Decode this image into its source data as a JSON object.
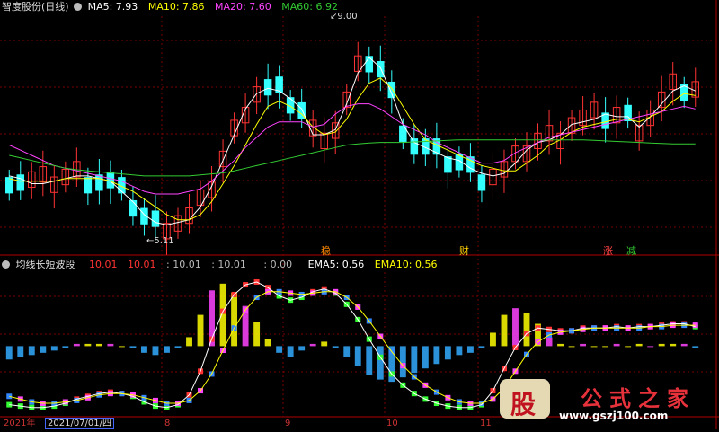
{
  "top_panel": {
    "title": "智度股份(日线)",
    "ma_labels": [
      {
        "text": "MA5: 7.93",
        "color": "#ffffff"
      },
      {
        "text": "MA10: 7.86",
        "color": "#ffff00"
      },
      {
        "text": "MA20: 7.60",
        "color": "#ff44ff"
      },
      {
        "text": "MA60: 6.92",
        "color": "#33cc33"
      }
    ],
    "high_label": "9.00",
    "low_label": "5.11",
    "events": [
      {
        "text": "稳",
        "color": "#ff8800"
      },
      {
        "text": "财",
        "color": "#ffd000"
      },
      {
        "text": "涨",
        "color": "#ff4444"
      },
      {
        "text": "减",
        "color": "#33cc33"
      }
    ]
  },
  "bottom_panel": {
    "title": "均线长短波段",
    "values": [
      {
        "text": "10.01",
        "color": "#ff3333"
      },
      {
        "text": "10.01",
        "color": "#ff3333"
      },
      {
        "text": ": 10.01",
        "color": "#bbbbbb"
      },
      {
        "text": ": 10.01",
        "color": "#bbbbbb"
      },
      {
        "text": ": 0.00",
        "color": "#bbbbbb"
      },
      {
        "text": "EMA5: 0.56",
        "color": "#ffffff"
      },
      {
        "text": "EMA10: 0.56",
        "color": "#ffff00"
      }
    ]
  },
  "x_axis": {
    "labels": [
      "2021年",
      "2021/07/01/四",
      "8",
      "9",
      "10",
      "11"
    ]
  },
  "logo": {
    "badge": "股",
    "name": "公式之家",
    "url": "www.gszj100.com"
  },
  "colors": {
    "up": "#ff3333",
    "down": "#33ffff",
    "ma5": "#ffffff",
    "ma10": "#ffff00",
    "ma20": "#ff44ff",
    "ma60": "#33cc33",
    "grid": "#7a0000"
  },
  "chart_data": {
    "type": "candlestick",
    "panels": [
      {
        "name": "price",
        "title": "智度股份(日线)",
        "ylim": [
          4.8,
          9.4
        ],
        "annotations": [
          "9.00",
          "5.11"
        ],
        "series": [
          {
            "name": "MA5",
            "last": 7.93,
            "values": [
              6.3,
              6.25,
              6.15,
              6.15,
              6.2,
              6.25,
              6.3,
              6.3,
              6.25,
              6.2,
              6.0,
              5.8,
              5.55,
              5.4,
              5.35,
              5.4,
              5.45,
              5.7,
              6.1,
              6.6,
              7.1,
              7.6,
              7.9,
              8.0,
              7.95,
              7.8,
              7.6,
              7.1,
              7.1,
              7.2,
              7.7,
              8.3,
              8.6,
              8.4,
              7.9,
              7.3,
              6.95,
              6.85,
              6.75,
              6.65,
              6.6,
              6.45,
              6.35,
              6.3,
              6.35,
              6.55,
              6.8,
              6.95,
              7.0,
              7.1,
              7.3,
              7.35,
              7.4,
              7.5,
              7.45,
              7.45,
              7.25,
              7.45,
              7.7,
              7.95,
              8.05,
              7.95
            ]
          },
          {
            "name": "MA10",
            "last": 7.86,
            "values": [
              6.25,
              6.2,
              6.2,
              6.2,
              6.2,
              6.25,
              6.25,
              6.25,
              6.25,
              6.2,
              6.1,
              6.0,
              5.85,
              5.7,
              5.55,
              5.45,
              5.45,
              5.55,
              5.8,
              6.15,
              6.5,
              6.9,
              7.3,
              7.65,
              7.75,
              7.65,
              7.5,
              7.25,
              7.1,
              7.15,
              7.4,
              7.8,
              8.1,
              8.2,
              8.0,
              7.65,
              7.3,
              7.0,
              6.9,
              6.8,
              6.7,
              6.6,
              6.5,
              6.45,
              6.4,
              6.4,
              6.55,
              6.7,
              6.9,
              7.0,
              7.15,
              7.25,
              7.3,
              7.35,
              7.4,
              7.4,
              7.35,
              7.45,
              7.55,
              7.75,
              7.9,
              7.86
            ]
          },
          {
            "name": "MA20",
            "last": 7.6,
            "values": [
              6.9,
              6.8,
              6.7,
              6.6,
              6.5,
              6.45,
              6.4,
              6.35,
              6.3,
              6.25,
              6.2,
              6.1,
              6.0,
              5.95,
              5.95,
              5.95,
              6.0,
              6.05,
              6.2,
              6.4,
              6.6,
              6.85,
              7.05,
              7.25,
              7.35,
              7.35,
              7.35,
              7.25,
              7.3,
              7.5,
              7.65,
              7.7,
              7.7,
              7.6,
              7.45,
              7.3,
              7.2,
              7.1,
              6.95,
              6.85,
              6.75,
              6.65,
              6.55,
              6.55,
              6.6,
              6.75,
              6.85,
              6.95,
              7.05,
              7.1,
              7.15,
              7.2,
              7.25,
              7.3,
              7.35,
              7.4,
              7.45,
              7.5,
              7.55,
              7.6,
              7.65,
              7.6
            ]
          },
          {
            "name": "MA60",
            "last": 6.92,
            "values": [
              6.7,
              6.65,
              6.6,
              6.55,
              6.5,
              6.45,
              6.42,
              6.4,
              6.38,
              6.36,
              6.34,
              6.32,
              6.3,
              6.3,
              6.3,
              6.3,
              6.3,
              6.32,
              6.34,
              6.36,
              6.4,
              6.45,
              6.5,
              6.55,
              6.6,
              6.65,
              6.7,
              6.75,
              6.8,
              6.85,
              6.9,
              6.92,
              6.94,
              6.95,
              6.95,
              6.95,
              6.96,
              6.97,
              6.98,
              6.99,
              7.0,
              7.0,
              7.0,
              7.0,
              7.0,
              7.0,
              7.0,
              7.0,
              7.0,
              7.0,
              7.0,
              7.0,
              6.99,
              6.98,
              6.97,
              6.96,
              6.95,
              6.94,
              6.93,
              6.92,
              6.92,
              6.92
            ]
          }
        ]
      },
      {
        "name": "band",
        "title": "均线长短波段",
        "ylim": [
          0,
          10.5
        ],
        "series": [
          {
            "name": "EMA5",
            "last": 0.56,
            "values": [
              0.8,
              0.7,
              0.6,
              0.6,
              0.7,
              0.9,
              1.2,
              1.4,
              1.6,
              1.7,
              1.6,
              1.4,
              1.0,
              0.7,
              0.6,
              0.8,
              1.5,
              3.2,
              5.5,
              7.5,
              8.7,
              9.4,
              9.6,
              9.2,
              8.6,
              8.3,
              8.5,
              8.9,
              9.1,
              8.8,
              8.0,
              6.9,
              5.5,
              4.2,
              3.0,
              2.2,
              1.6,
              1.2,
              0.9,
              0.7,
              0.6,
              0.6,
              0.8,
              1.8,
              3.4,
              4.9,
              5.9,
              6.3,
              6.2,
              6.1,
              6.1,
              6.3,
              6.3,
              6.3,
              6.4,
              6.3,
              6.4,
              6.4,
              6.5,
              6.6,
              6.6,
              6.4
            ]
          },
          {
            "name": "EMA10",
            "last": 0.56,
            "values": [
              1.4,
              1.2,
              1.0,
              0.9,
              0.9,
              1.0,
              1.1,
              1.3,
              1.5,
              1.6,
              1.6,
              1.5,
              1.3,
              1.1,
              0.9,
              0.9,
              1.1,
              1.8,
              3.0,
              4.7,
              6.3,
              7.6,
              8.5,
              8.9,
              8.9,
              8.8,
              8.7,
              8.8,
              8.9,
              8.9,
              8.5,
              7.8,
              6.8,
              5.7,
              4.6,
              3.6,
              2.8,
              2.2,
              1.7,
              1.3,
              1.0,
              0.9,
              0.9,
              1.2,
              2.0,
              3.2,
              4.4,
              5.3,
              5.8,
              6.0,
              6.1,
              6.2,
              6.3,
              6.3,
              6.3,
              6.3,
              6.3,
              6.4,
              6.4,
              6.5,
              6.5,
              6.5
            ]
          }
        ]
      }
    ],
    "xlabels": [
      "2021年",
      "2021/07/01/四",
      "8",
      "9",
      "10",
      "11"
    ]
  }
}
